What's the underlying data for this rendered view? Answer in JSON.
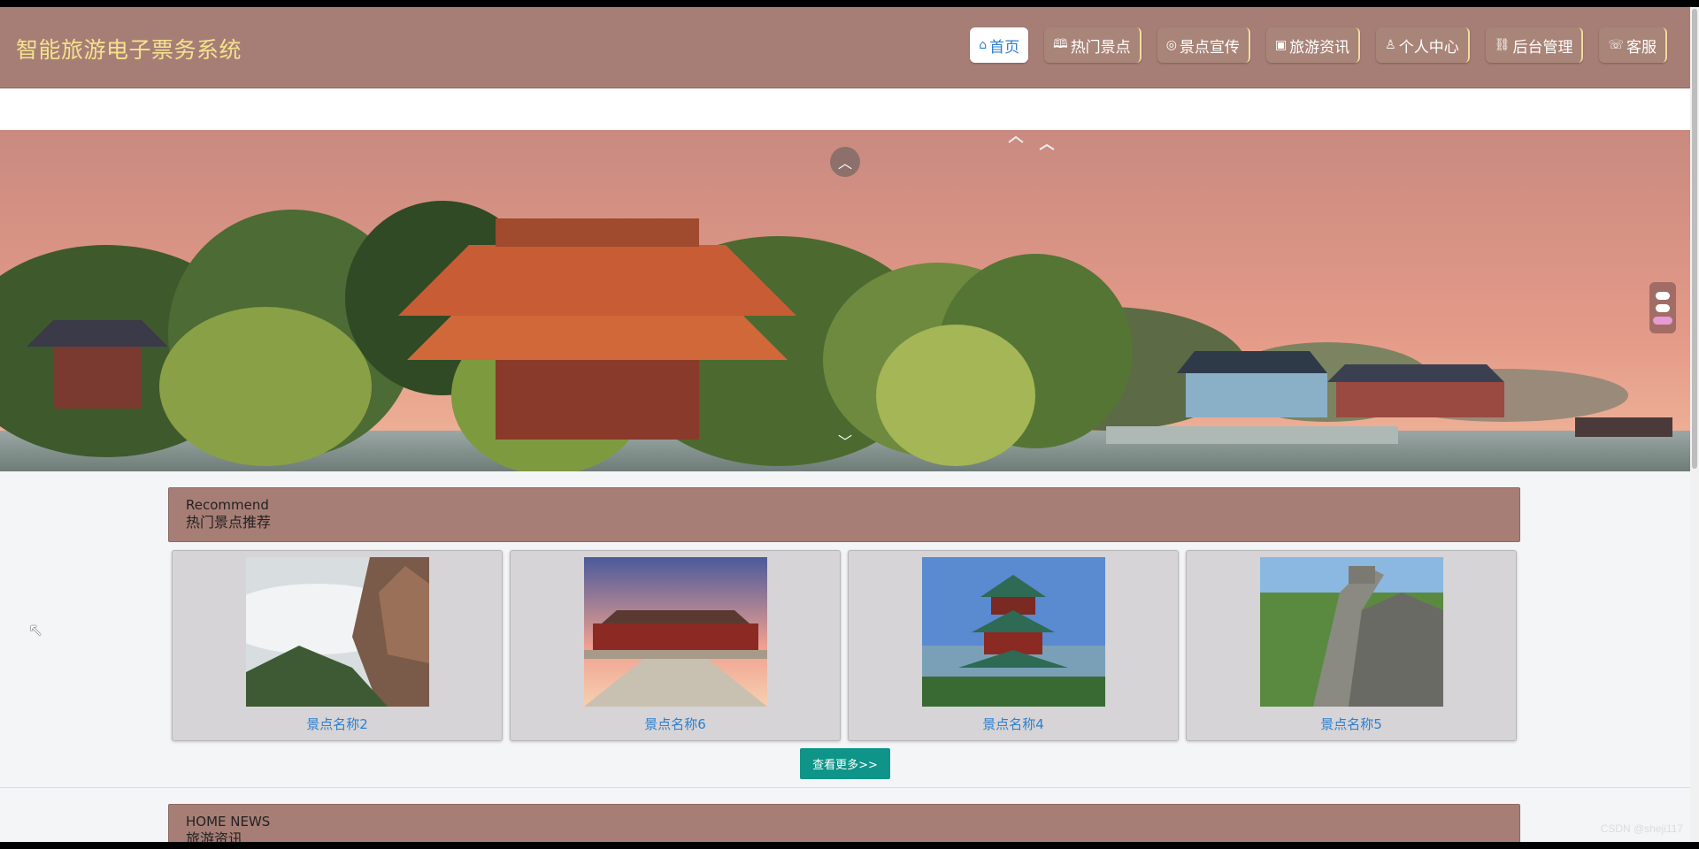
{
  "header": {
    "title": "智能旅游电子票务系统",
    "nav": [
      {
        "label": "首页",
        "icon": "home-icon",
        "glyph": "⌂",
        "active": true
      },
      {
        "label": "热门景点",
        "icon": "map-icon",
        "glyph": "🕮",
        "active": false
      },
      {
        "label": "景点宣传",
        "icon": "compass-icon",
        "glyph": "◎",
        "active": false
      },
      {
        "label": "旅游资讯",
        "icon": "gift-icon",
        "glyph": "▣",
        "active": false
      },
      {
        "label": "个人中心",
        "icon": "user-icon",
        "glyph": "♙",
        "active": false
      },
      {
        "label": "后台管理",
        "icon": "link-icon",
        "glyph": "⛓",
        "active": false
      },
      {
        "label": "客服",
        "icon": "support-icon",
        "glyph": "☏",
        "active": false
      }
    ]
  },
  "banner": {
    "up_icon": "chevron-up-icon",
    "down_icon": "chevron-down-icon",
    "up_glyph": "︿",
    "down_glyph": "﹀"
  },
  "recommend": {
    "title_en": "Recommend",
    "title_cn": "热门景点推荐",
    "cards": [
      {
        "name": "景点名称2"
      },
      {
        "name": "景点名称6"
      },
      {
        "name": "景点名称4"
      },
      {
        "name": "景点名称5"
      }
    ],
    "more_label": "查看更多>>"
  },
  "news": {
    "title_en": "HOME NEWS",
    "title_cn": "旅游资讯"
  },
  "watermark": "CSDN @sheji117",
  "colors": {
    "header_bg": "#a77e76",
    "logo": "#f4e28d",
    "link": "#2d7fd0",
    "button": "#0e9488"
  }
}
